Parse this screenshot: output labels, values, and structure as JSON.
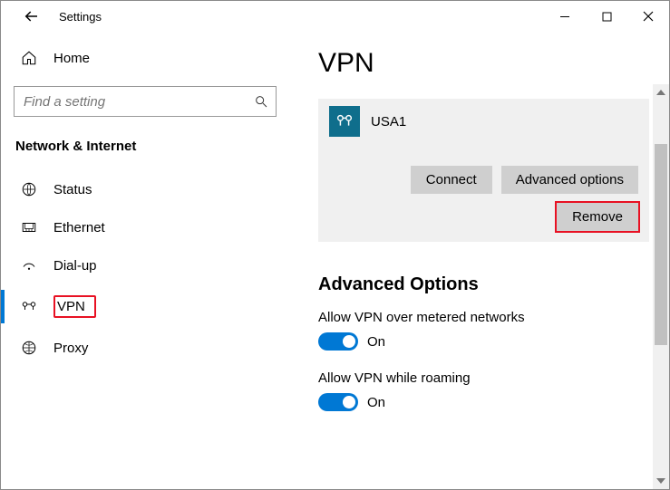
{
  "window": {
    "title": "Settings"
  },
  "sidebar": {
    "home_label": "Home",
    "search_placeholder": "Find a setting",
    "category": "Network & Internet",
    "items": [
      {
        "label": "Status"
      },
      {
        "label": "Ethernet"
      },
      {
        "label": "Dial-up"
      },
      {
        "label": "VPN"
      },
      {
        "label": "Proxy"
      }
    ]
  },
  "main": {
    "heading": "VPN",
    "connection": {
      "name": "USA1",
      "connect_label": "Connect",
      "advanced_label": "Advanced options",
      "remove_label": "Remove"
    },
    "advanced_heading": "Advanced Options",
    "options": [
      {
        "label": "Allow VPN over metered networks",
        "state": "On"
      },
      {
        "label": "Allow VPN while roaming",
        "state": "On"
      }
    ]
  }
}
